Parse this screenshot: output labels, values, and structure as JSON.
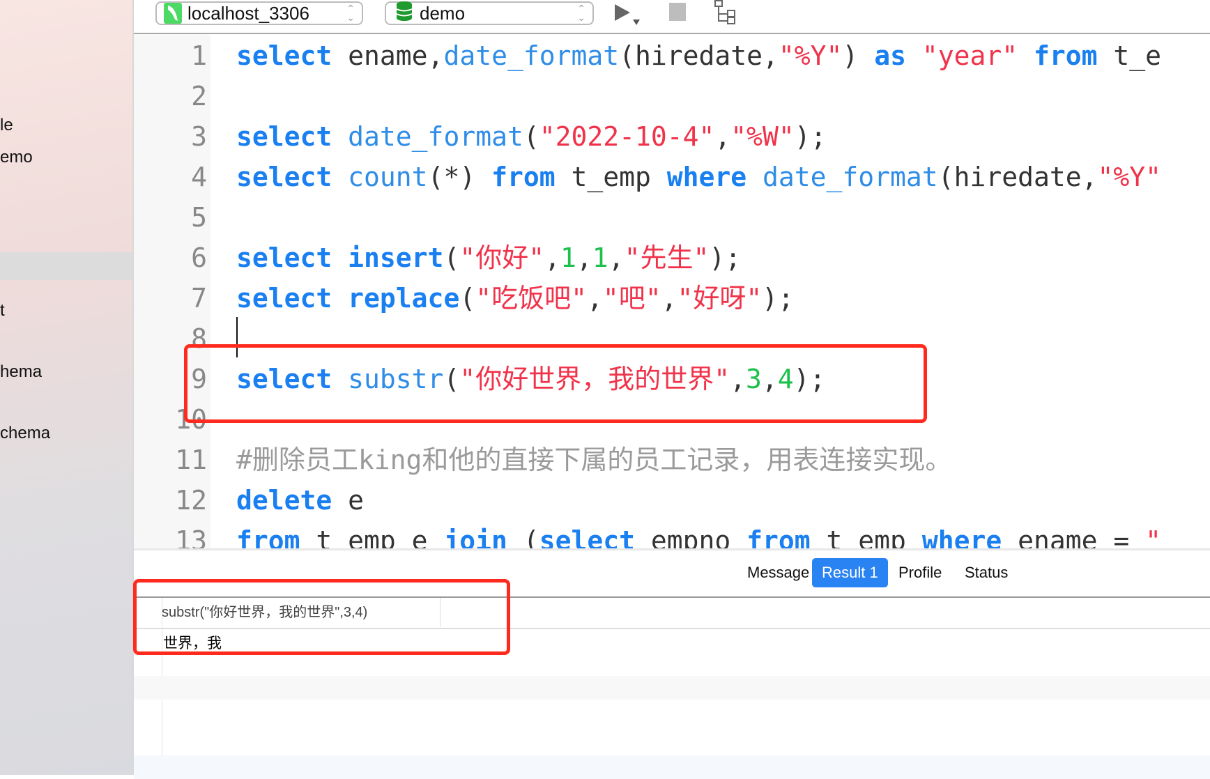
{
  "sidebar": {
    "items": [
      "le",
      "emo",
      "t",
      "hema",
      "chema"
    ]
  },
  "toolbar": {
    "connection": {
      "label": "localhost_3306",
      "icon": "mysql-dolphin-icon",
      "color": "#4cd964"
    },
    "database": {
      "label": "demo",
      "icon": "database-icon",
      "color": "#1e9a2e"
    },
    "run_icon": "play-icon",
    "stop_icon": "stop-icon",
    "explain_icon": "tree-icon"
  },
  "editor": {
    "lines": [
      {
        "n": "1",
        "tokens": [
          [
            "select",
            "kw"
          ],
          [
            " ",
            "pl"
          ],
          [
            "ename,",
            "pl"
          ],
          [
            "date_format",
            "fn"
          ],
          [
            "(hiredate,",
            "pl"
          ],
          [
            "\"%Y\"",
            "str"
          ],
          [
            ") ",
            "pl"
          ],
          [
            "as",
            "kw"
          ],
          [
            " ",
            "pl"
          ],
          [
            "\"year\"",
            "str"
          ],
          [
            " ",
            "pl"
          ],
          [
            "from",
            "kw"
          ],
          [
            " t_e",
            "pl"
          ]
        ]
      },
      {
        "n": "2",
        "tokens": []
      },
      {
        "n": "3",
        "tokens": [
          [
            "select",
            "kw"
          ],
          [
            " ",
            "pl"
          ],
          [
            "date_format",
            "fn"
          ],
          [
            "(",
            "pl"
          ],
          [
            "\"2022-10-4\"",
            "str"
          ],
          [
            ",",
            "pl"
          ],
          [
            "\"%W\"",
            "str"
          ],
          [
            ");",
            "pl"
          ]
        ]
      },
      {
        "n": "4",
        "tokens": [
          [
            "select",
            "kw"
          ],
          [
            " ",
            "pl"
          ],
          [
            "count",
            "fn"
          ],
          [
            "(*) ",
            "pl"
          ],
          [
            "from",
            "kw"
          ],
          [
            " t_emp ",
            "pl"
          ],
          [
            "where",
            "kw"
          ],
          [
            " ",
            "pl"
          ],
          [
            "date_format",
            "fn"
          ],
          [
            "(hiredate,",
            "pl"
          ],
          [
            "\"%Y\"",
            "str"
          ]
        ]
      },
      {
        "n": "5",
        "tokens": []
      },
      {
        "n": "6",
        "tokens": [
          [
            "select",
            "kw"
          ],
          [
            " ",
            "pl"
          ],
          [
            "insert",
            "kw"
          ],
          [
            "(",
            "pl"
          ],
          [
            "\"你好\"",
            "str"
          ],
          [
            ",",
            "pl"
          ],
          [
            "1",
            "num"
          ],
          [
            ",",
            "pl"
          ],
          [
            "1",
            "num"
          ],
          [
            ",",
            "pl"
          ],
          [
            "\"先生\"",
            "str"
          ],
          [
            ");",
            "pl"
          ]
        ]
      },
      {
        "n": "7",
        "tokens": [
          [
            "select",
            "kw"
          ],
          [
            " ",
            "pl"
          ],
          [
            "replace",
            "kw"
          ],
          [
            "(",
            "pl"
          ],
          [
            "\"吃饭吧\"",
            "str"
          ],
          [
            ",",
            "pl"
          ],
          [
            "\"吧\"",
            "str"
          ],
          [
            ",",
            "pl"
          ],
          [
            "\"好呀\"",
            "str"
          ],
          [
            ");",
            "pl"
          ]
        ]
      },
      {
        "n": "8",
        "tokens": []
      },
      {
        "n": "9",
        "tokens": [
          [
            "select",
            "kw"
          ],
          [
            " ",
            "pl"
          ],
          [
            "substr",
            "fn"
          ],
          [
            "(",
            "pl"
          ],
          [
            "\"你好世界，我的世界\"",
            "str"
          ],
          [
            ",",
            "pl"
          ],
          [
            "3",
            "num"
          ],
          [
            ",",
            "pl"
          ],
          [
            "4",
            "num"
          ],
          [
            ");",
            "pl"
          ]
        ]
      },
      {
        "n": "10",
        "tokens": []
      },
      {
        "n": "11",
        "tokens": [
          [
            "#删除员工king和他的直接下属的员工记录，用表连接实现。",
            "cm"
          ]
        ]
      },
      {
        "n": "12",
        "tokens": [
          [
            "delete",
            "kw"
          ],
          [
            " e",
            "pl"
          ]
        ]
      },
      {
        "n": "13",
        "tokens": [
          [
            "from",
            "kw"
          ],
          [
            " t_emp e ",
            "pl"
          ],
          [
            "join",
            "kw"
          ],
          [
            " (",
            "pl"
          ],
          [
            "select",
            "kw"
          ],
          [
            " empno ",
            "pl"
          ],
          [
            "from",
            "kw"
          ],
          [
            " t_emp ",
            "pl"
          ],
          [
            "where",
            "kw"
          ],
          [
            " ename = ",
            "pl"
          ],
          [
            "\"",
            "str"
          ]
        ]
      }
    ]
  },
  "results": {
    "tabs": [
      {
        "label": "Message",
        "active": false
      },
      {
        "label": "Result 1",
        "active": true
      },
      {
        "label": "Profile",
        "active": false
      },
      {
        "label": "Status",
        "active": false
      }
    ],
    "columns": [
      "substr(\"你好世界，我的世界\",3,4)"
    ],
    "rows": [
      [
        "世界，我"
      ]
    ]
  },
  "colors": {
    "accent": "#2a83f3",
    "highlight_box": "#ff2a1e",
    "keyword": "#1a7ff0",
    "string": "#f0334a",
    "number": "#1cc04a"
  }
}
